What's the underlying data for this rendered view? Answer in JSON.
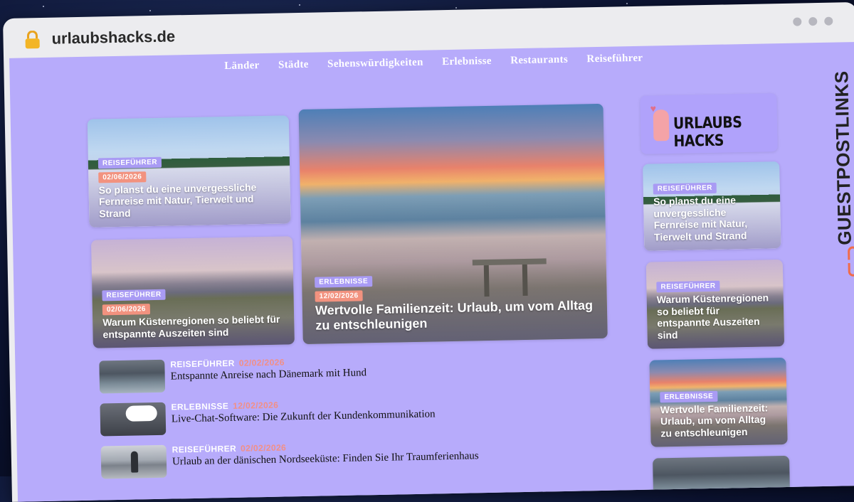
{
  "browser": {
    "url": "urlaubshacks.de"
  },
  "nav": {
    "items": [
      "Länder",
      "Städte",
      "Sehenswürdigkeiten",
      "Erlebnisse",
      "Restaurants",
      "Reiseführer"
    ]
  },
  "featured": {
    "left_top": {
      "category": "REISEFÜHRER",
      "date": "02/06/2026",
      "title": "So planst du eine unvergessliche Fernreise mit Natur, Tierwelt und Strand"
    },
    "left_bottom": {
      "category": "REISEFÜHRER",
      "date": "02/06/2026",
      "title": "Warum Küstenregionen so beliebt für entspannte Auszeiten sind"
    },
    "main": {
      "category": "ERLEBNISSE",
      "date": "12/02/2026",
      "title": "Wertvolle Familienzeit: Urlaub, um vom Alltag zu entschleunigen"
    }
  },
  "list": [
    {
      "category": "REISEFÜHRER",
      "date": "02/02/2026",
      "title": "Entspannte Anreise nach Dänemark mit Hund",
      "icon": "dog-photo"
    },
    {
      "category": "ERLEBNISSE",
      "date": "12/02/2026",
      "title": "Live-Chat-Software: Die Zukunft der Kundenkommunikation",
      "icon": "chat-bubble-photo"
    },
    {
      "category": "REISEFÜHRER",
      "date": "02/02/2026",
      "title": "Urlaub an der dänischen Nordseeküste: Finden Sie Ihr Traumferienhaus",
      "icon": "beach-person-photo"
    }
  ],
  "sidebar": {
    "logo_text": "URLAUBS HACKS",
    "cards": [
      {
        "category": "REISEFÜHRER",
        "title": "So planst du eine unvergessliche Fernreise mit Natur, Tierwelt und Strand"
      },
      {
        "category": "REISEFÜHRER",
        "title": "Warum Küstenregionen so beliebt für entspannte Auszeiten sind"
      },
      {
        "category": "ERLEBNISSE",
        "title": "Wertvolle Familienzeit: Urlaub, um vom Alltag zu entschleunigen"
      }
    ]
  },
  "brand_strip": {
    "text": "GUESTPOSTLINKS"
  },
  "colors": {
    "page_background": "#b7abfb",
    "category_badge": "#a99bf4",
    "date_badge": "#f2927f"
  }
}
